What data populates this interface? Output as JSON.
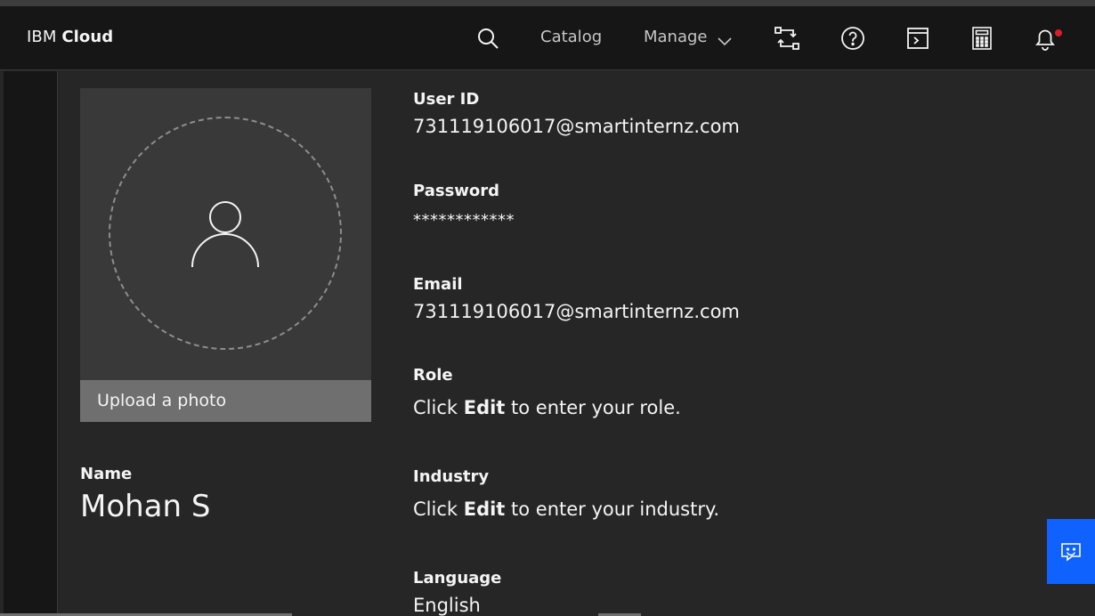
{
  "header": {
    "brand_prefix": "IBM",
    "brand_name": "Cloud",
    "catalog_label": "Catalog",
    "manage_label": "Manage",
    "icons": [
      "search-icon",
      "chevron-down-icon",
      "switch-account-icon",
      "help-icon",
      "cloud-shell-icon",
      "cost-estimator-icon",
      "notification-icon"
    ],
    "notification_dot_color": "#da1e28"
  },
  "profile_photo": {
    "upload_label": "Upload a photo",
    "icon": "user-avatar-icon"
  },
  "name": {
    "label": "Name",
    "value": "Mohan S"
  },
  "fields": {
    "user_id": {
      "label": "User ID",
      "value": "731119106017@smartinternz.com"
    },
    "password": {
      "label": "Password",
      "value": "************"
    },
    "email": {
      "label": "Email",
      "value": "731119106017@smartinternz.com"
    },
    "role": {
      "label": "Role",
      "prefix": "Click ",
      "action": "Edit",
      "suffix": " to enter your role."
    },
    "industry": {
      "label": "Industry",
      "prefix": "Click ",
      "action": "Edit",
      "suffix": " to enter your industry."
    },
    "language": {
      "label": "Language",
      "value": "English"
    }
  },
  "feedback": {
    "icon": "feedback-chat-icon",
    "color": "#0f62fe"
  },
  "colors": {
    "header_bg": "#161616",
    "page_bg": "#262626",
    "card_bg": "#393939",
    "upload_bar_bg": "#6f6f6f",
    "accent": "#0f62fe"
  }
}
